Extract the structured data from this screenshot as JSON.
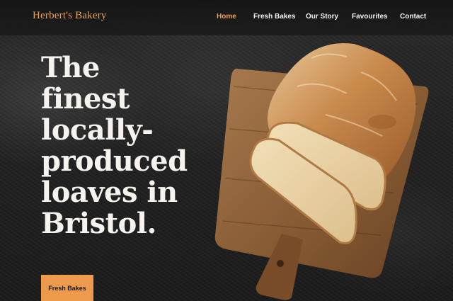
{
  "brand": {
    "name": "Herbert's Bakery"
  },
  "nav": {
    "items": [
      "Home",
      "Fresh Bakes",
      "Our Story",
      "Favourites",
      "Contact"
    ],
    "active": "Home"
  },
  "hero": {
    "heading_lines": [
      "The finest",
      "locally-",
      "produced",
      "loaves in",
      "Bristol."
    ],
    "cta_label": "Fresh Bakes",
    "image": "bread-on-cutting-board"
  },
  "colors": {
    "accent": "#e8a15a",
    "cta_background": "#ee9a4d",
    "background": "#1f1f1f",
    "heading_text": "#f6f3ee"
  }
}
